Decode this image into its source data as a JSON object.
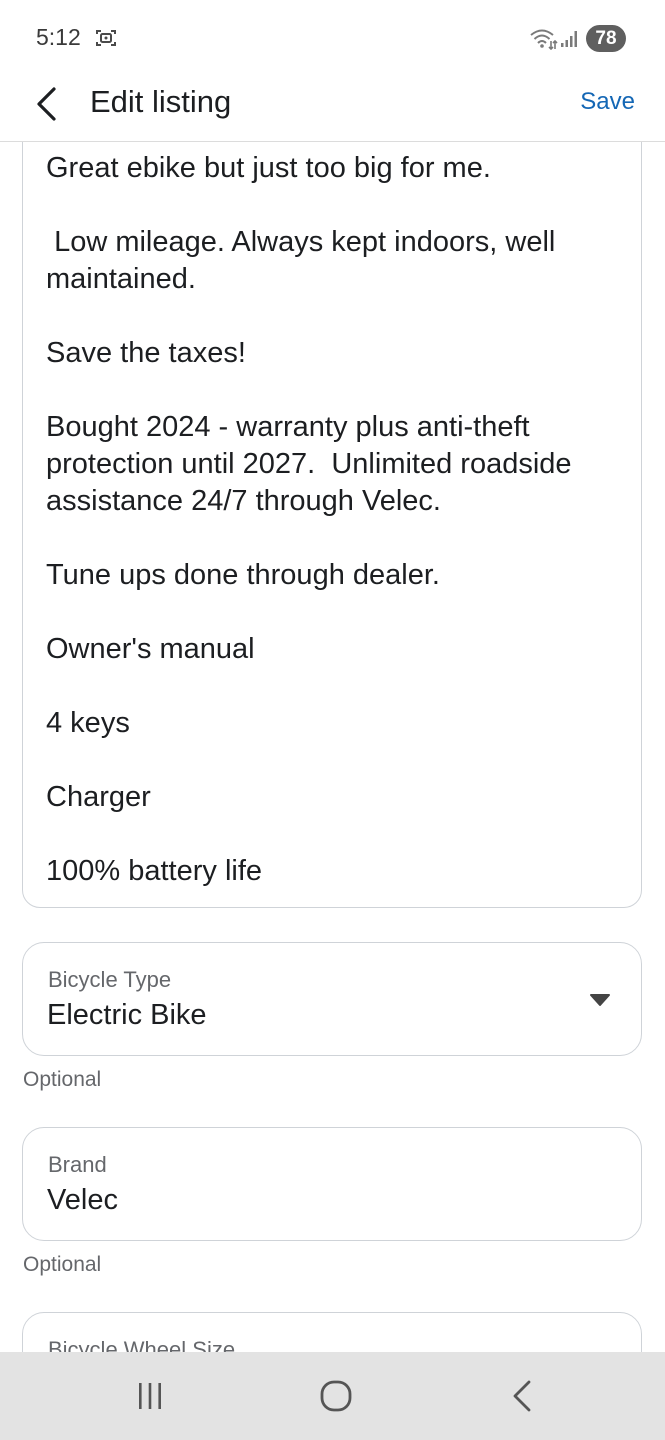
{
  "status_bar": {
    "time": "5:12",
    "battery": "78",
    "icons": [
      "screenshot-icon",
      "wifi-icon",
      "signal-icon"
    ]
  },
  "app_bar": {
    "title": "Edit listing",
    "save_label": "Save",
    "back_icon": "chevron-left-icon",
    "accent_color": "#1467b5"
  },
  "description": {
    "text": "Great ebike but just too big for me.\n\n Low mileage. Always kept indoors, well maintained.\n\nSave the taxes!\n\nBought 2024 - warranty plus anti-theft protection until 2027.  Unlimited roadside assistance 24/7 through Velec.\n\nTune ups done through dealer.\n\nOwner's manual\n\n4 keys\n\nCharger\n\n100% battery life"
  },
  "fields": {
    "bicycle_type": {
      "label": "Bicycle Type",
      "value": "Electric Bike",
      "helper": "Optional",
      "icon": "caret-down-icon"
    },
    "brand": {
      "label": "Brand",
      "value": "Velec",
      "helper": "Optional"
    },
    "wheel_size": {
      "label": "Bicycle Wheel Size"
    }
  },
  "nav_bar": {
    "icons": [
      "recent-apps-icon",
      "home-icon",
      "back-icon"
    ]
  }
}
